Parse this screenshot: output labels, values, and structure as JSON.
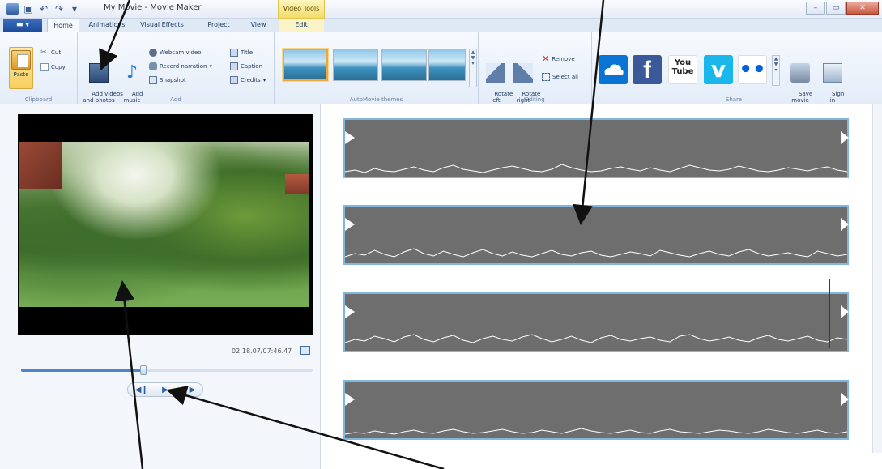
{
  "window": {
    "title": "My Movie - Movie Maker",
    "context_tab_header": "Video Tools"
  },
  "tabs": [
    {
      "label": "Home",
      "active": true
    },
    {
      "label": "Animations",
      "active": false
    },
    {
      "label": "Visual Effects",
      "active": false
    },
    {
      "label": "Project",
      "active": false
    },
    {
      "label": "View",
      "active": false
    },
    {
      "label": "Edit",
      "active": false,
      "context": true
    }
  ],
  "ribbon": {
    "clipboard": {
      "label": "Clipboard",
      "paste": "Paste",
      "cut": "Cut",
      "copy": "Copy"
    },
    "add": {
      "label": "Add",
      "add_videos": "Add videos\nand photos",
      "add_music": "Add\nmusic",
      "webcam_video": "Webcam video",
      "record_narration": "Record narration",
      "snapshot": "Snapshot",
      "title": "Title",
      "caption": "Caption",
      "credits": "Credits"
    },
    "themes": {
      "label": "AutoMovie themes"
    },
    "editing": {
      "label": "Editing",
      "rotate_left": "Rotate\nleft",
      "rotate_right": "Rotate\nright",
      "remove": "Remove",
      "select_all": "Select all"
    },
    "share": {
      "label": "Share",
      "save_movie": "Save\nmovie",
      "sign_in": "Sign\nin",
      "services": [
        {
          "name": "onedrive-icon",
          "color": "#0a74d4",
          "text": ""
        },
        {
          "name": "facebook-icon",
          "color": "#3b5998",
          "text": "f"
        },
        {
          "name": "youtube-icon",
          "color": "#ffffff",
          "text": "You Tube"
        },
        {
          "name": "vimeo-icon",
          "color": "#1ab7ea",
          "text": "v"
        },
        {
          "name": "flickr-icon",
          "color": "#ffffff",
          "text": "••"
        }
      ]
    }
  },
  "preview": {
    "timecode": "02:18.07/07:46.47",
    "seek_position": 0.42
  },
  "storyboard": {
    "clips": [
      {
        "waveform": [
          4,
          6,
          3,
          8,
          5,
          4,
          7,
          10,
          6,
          4,
          9,
          12,
          7,
          5,
          3,
          6,
          9,
          11,
          8,
          5,
          4,
          7,
          13,
          9,
          6,
          4,
          5,
          8,
          10,
          7,
          5,
          9,
          6,
          4,
          8,
          12,
          9,
          6,
          5,
          7,
          11,
          8,
          5,
          4,
          6,
          9,
          7,
          5,
          8,
          10,
          6,
          4
        ]
      },
      {
        "waveform": [
          6,
          10,
          8,
          14,
          9,
          6,
          12,
          16,
          10,
          7,
          13,
          9,
          6,
          11,
          15,
          10,
          7,
          12,
          8,
          6,
          10,
          14,
          9,
          7,
          11,
          13,
          8,
          6,
          9,
          12,
          10,
          7,
          14,
          11,
          8,
          6,
          10,
          13,
          9,
          7,
          12,
          15,
          10,
          7,
          9,
          11,
          8,
          6,
          13,
          10,
          7,
          9
        ]
      },
      {
        "waveform": [
          8,
          12,
          10,
          16,
          13,
          9,
          15,
          18,
          12,
          9,
          14,
          17,
          11,
          8,
          13,
          16,
          12,
          10,
          15,
          18,
          13,
          9,
          12,
          16,
          11,
          8,
          14,
          17,
          12,
          10,
          13,
          15,
          11,
          9,
          16,
          18,
          13,
          10,
          12,
          15,
          11,
          9,
          14,
          17,
          12,
          10,
          13,
          16,
          11,
          9,
          14,
          12
        ]
      },
      {
        "waveform": [
          3,
          5,
          4,
          7,
          5,
          3,
          6,
          8,
          5,
          4,
          7,
          9,
          6,
          4,
          5,
          7,
          9,
          6,
          4,
          5,
          8,
          6,
          4,
          7,
          10,
          7,
          5,
          4,
          6,
          8,
          5,
          4,
          7,
          9,
          6,
          5,
          4,
          6,
          8,
          7,
          5,
          4,
          6,
          9,
          7,
          5,
          4,
          6,
          8,
          5,
          4,
          6
        ]
      }
    ]
  }
}
